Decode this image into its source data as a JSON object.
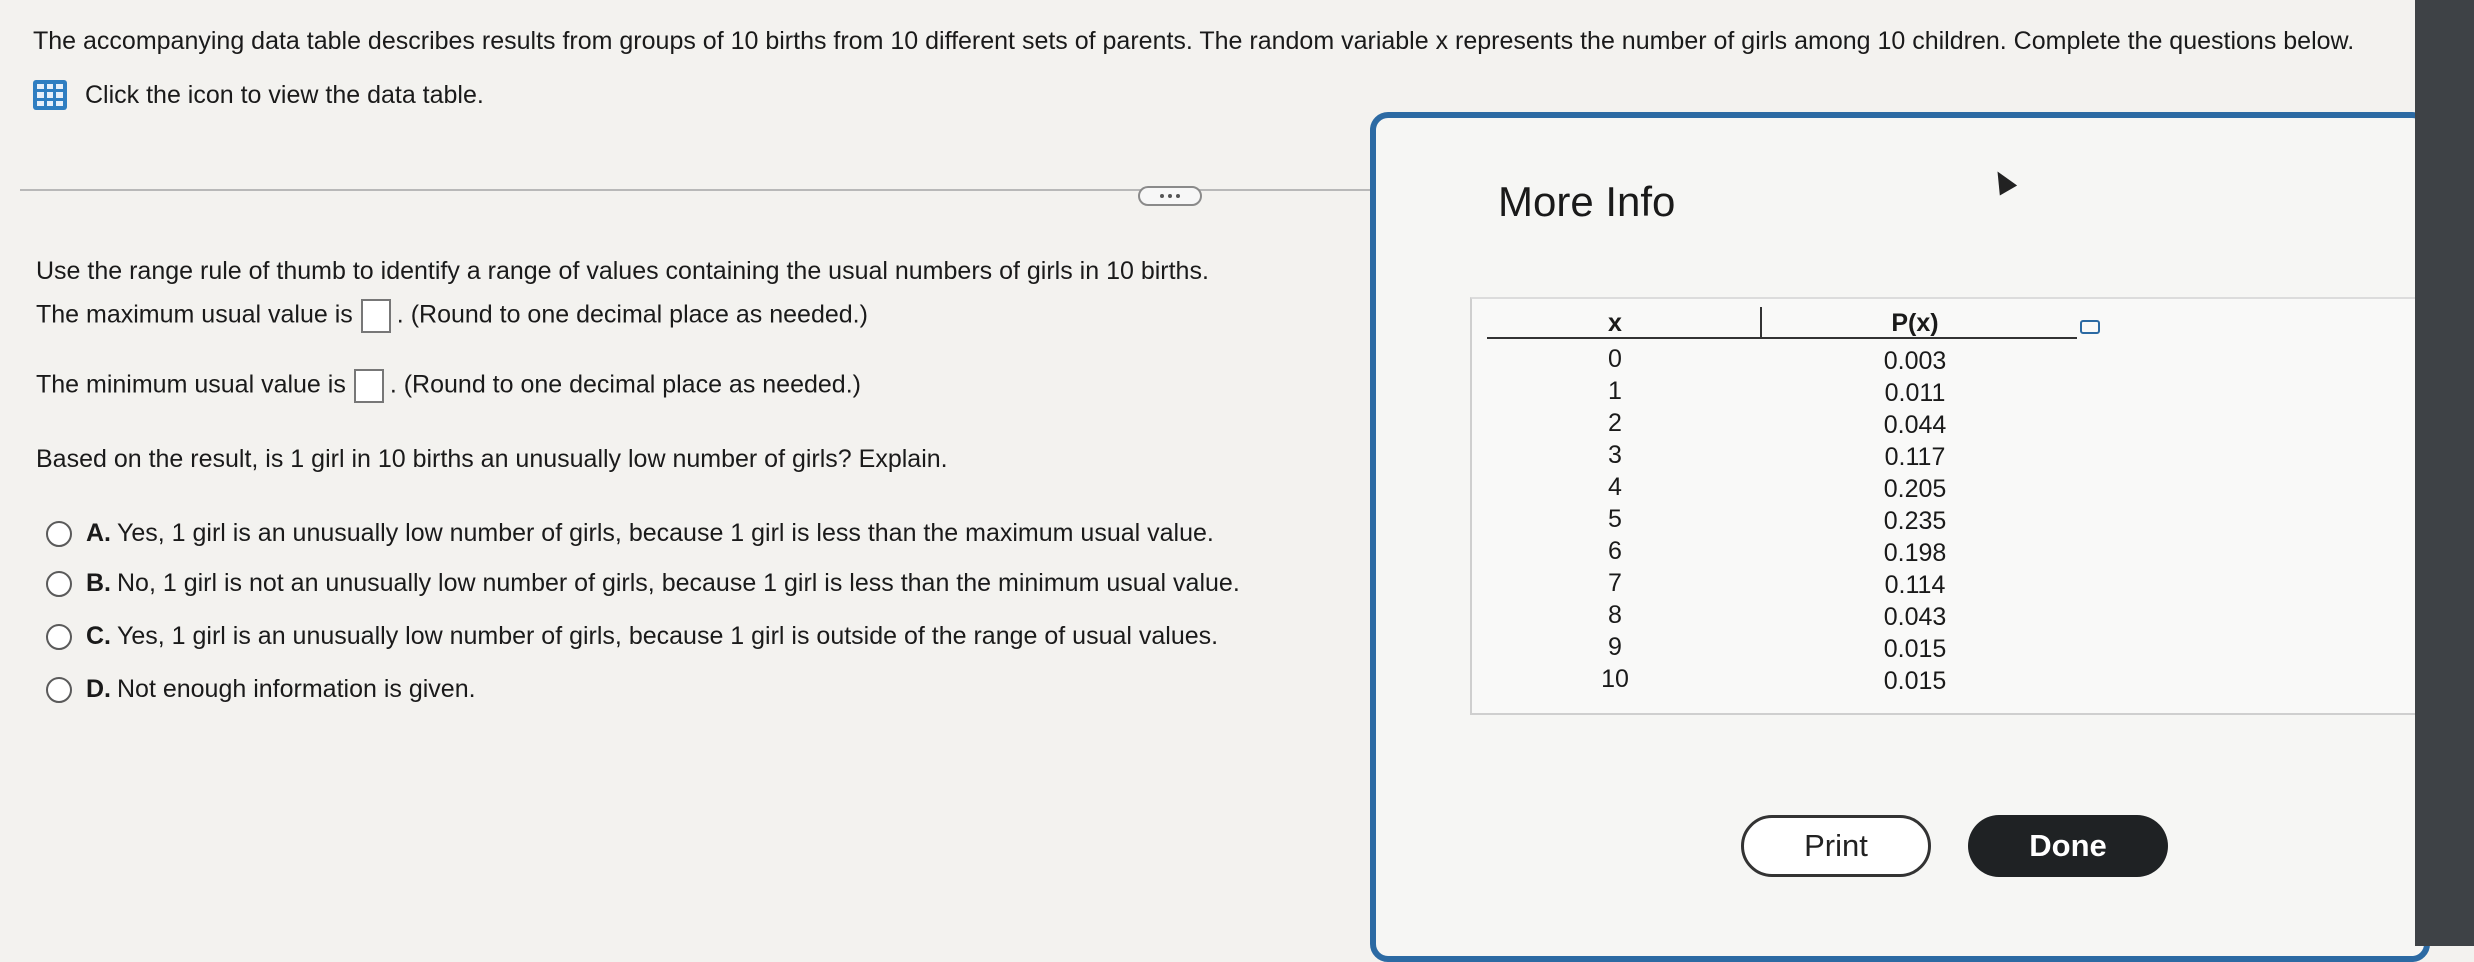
{
  "intro": "The accompanying data table describes results from groups of 10 births from 10 different sets of parents. The random variable x represents the number of girls among 10 children. Complete the questions below.",
  "view_table": "Click the icon to view the data table.",
  "q_range": "Use the range rule of thumb to identify a range of values containing the usual numbers of girls in 10 births.",
  "q_max_prefix": "The maximum usual value is",
  "q_max_suffix": ". (Round to one decimal place as needed.)",
  "q_min_prefix": "The minimum usual value is",
  "q_min_suffix": ". (Round to one decimal place as needed.)",
  "q_based": "Based on the result, is 1 girl in 10 births an unusually low number of girls? Explain.",
  "options": [
    {
      "letter": "A.",
      "text": "Yes, 1 girl is an unusually low number of girls, because 1 girl is less than the maximum usual value."
    },
    {
      "letter": "B.",
      "text": "No, 1 girl is not an unusually low number of girls, because 1 girl is less than the minimum usual value."
    },
    {
      "letter": "C.",
      "text": "Yes, 1 girl is an unusually low number of girls, because 1 girl is outside of the range of usual values."
    },
    {
      "letter": "D.",
      "text": "Not enough information is given."
    }
  ],
  "modal": {
    "title": "More Info",
    "col_x": "x",
    "col_p": "P(x)",
    "rows": [
      {
        "x": "0",
        "p": "0.003"
      },
      {
        "x": "1",
        "p": "0.011"
      },
      {
        "x": "2",
        "p": "0.044"
      },
      {
        "x": "3",
        "p": "0.117"
      },
      {
        "x": "4",
        "p": "0.205"
      },
      {
        "x": "5",
        "p": "0.235"
      },
      {
        "x": "6",
        "p": "0.198"
      },
      {
        "x": "7",
        "p": "0.114"
      },
      {
        "x": "8",
        "p": "0.043"
      },
      {
        "x": "9",
        "p": "0.015"
      },
      {
        "x": "10",
        "p": "0.015"
      }
    ],
    "print_label": "Print",
    "done_label": "Done"
  }
}
